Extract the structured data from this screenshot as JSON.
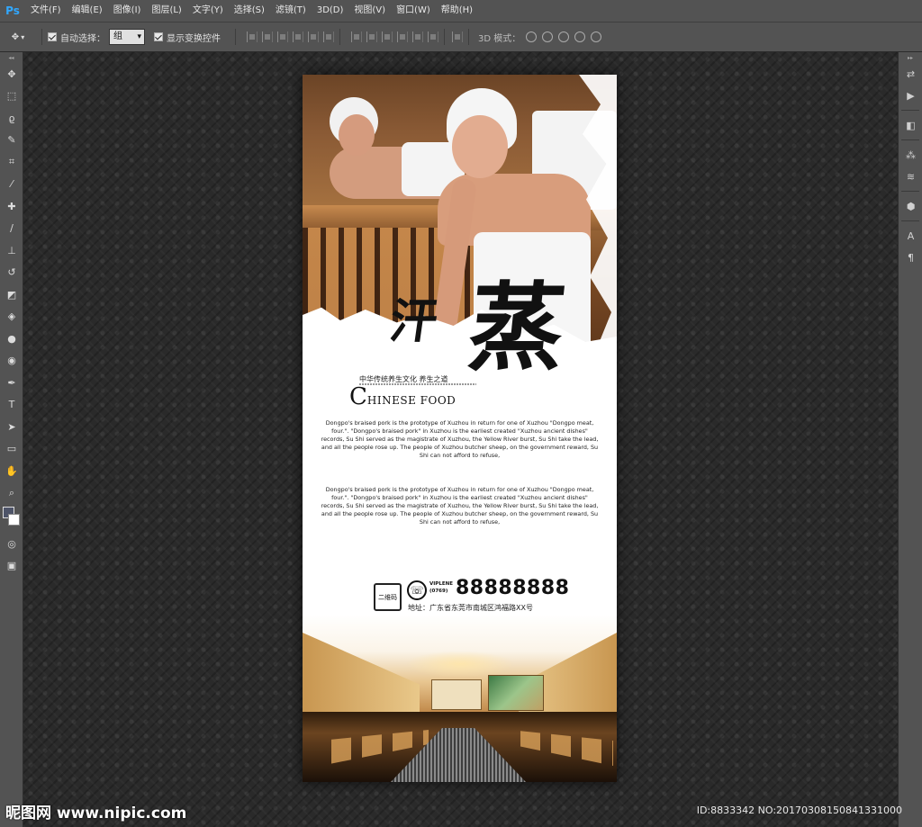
{
  "app": {
    "logo": "Ps",
    "menu": [
      "文件(F)",
      "编辑(E)",
      "图像(I)",
      "图层(L)",
      "文字(Y)",
      "选择(S)",
      "滤镜(T)",
      "3D(D)",
      "视图(V)",
      "窗口(W)",
      "帮助(H)"
    ]
  },
  "options": {
    "auto_select_label": "自动选择：",
    "auto_select_value": "组",
    "show_transform_label": "显示变换控件",
    "mode3d_label": "3D 模式："
  },
  "poster": {
    "title_small": "汗",
    "title_big": "蒸",
    "subtitle": "中华传统养生文化  养生之道",
    "brand_initial": "C",
    "brand_rest": "HINESE FOOD",
    "paragraph1": "Dongpo's braised pork is the prototype of Xuzhou in return for one of Xuzhou \"Dongpo meat, four.\". \"Dongpo's braised pork\" in Xuzhou is the earliest created \"Xuzhou ancient dishes\" records, Su Shi served as the magistrate of Xuzhou, the Yellow River burst, Su Shi take the lead, and all the people rose up. The people of Xuzhou butcher sheep, on the government reward, Su Shi can not afford to refuse,",
    "paragraph2": "Dongpo's braised pork is the prototype of Xuzhou in return for one of Xuzhou \"Dongpo meat, four.\". \"Dongpo's braised pork\" in Xuzhou is the earliest created \"Xuzhou ancient dishes\" records, Su Shi served as the magistrate of Xuzhou, the Yellow River burst, Su Shi take the lead, and all the people rose up. The people of Xuzhou butcher sheep, on the government reward, Su Shi can not afford to refuse,",
    "qr_label": "二维码",
    "vip_line1": "VIPLENE",
    "vip_line2": "(0769)",
    "phone": "88888888",
    "address": "地址：广东省东莞市南城区鸿福路XX号"
  },
  "watermark": {
    "site": "昵图网 www.nipic.com",
    "id": "ID:8833342 NO:20170308150841331000"
  }
}
